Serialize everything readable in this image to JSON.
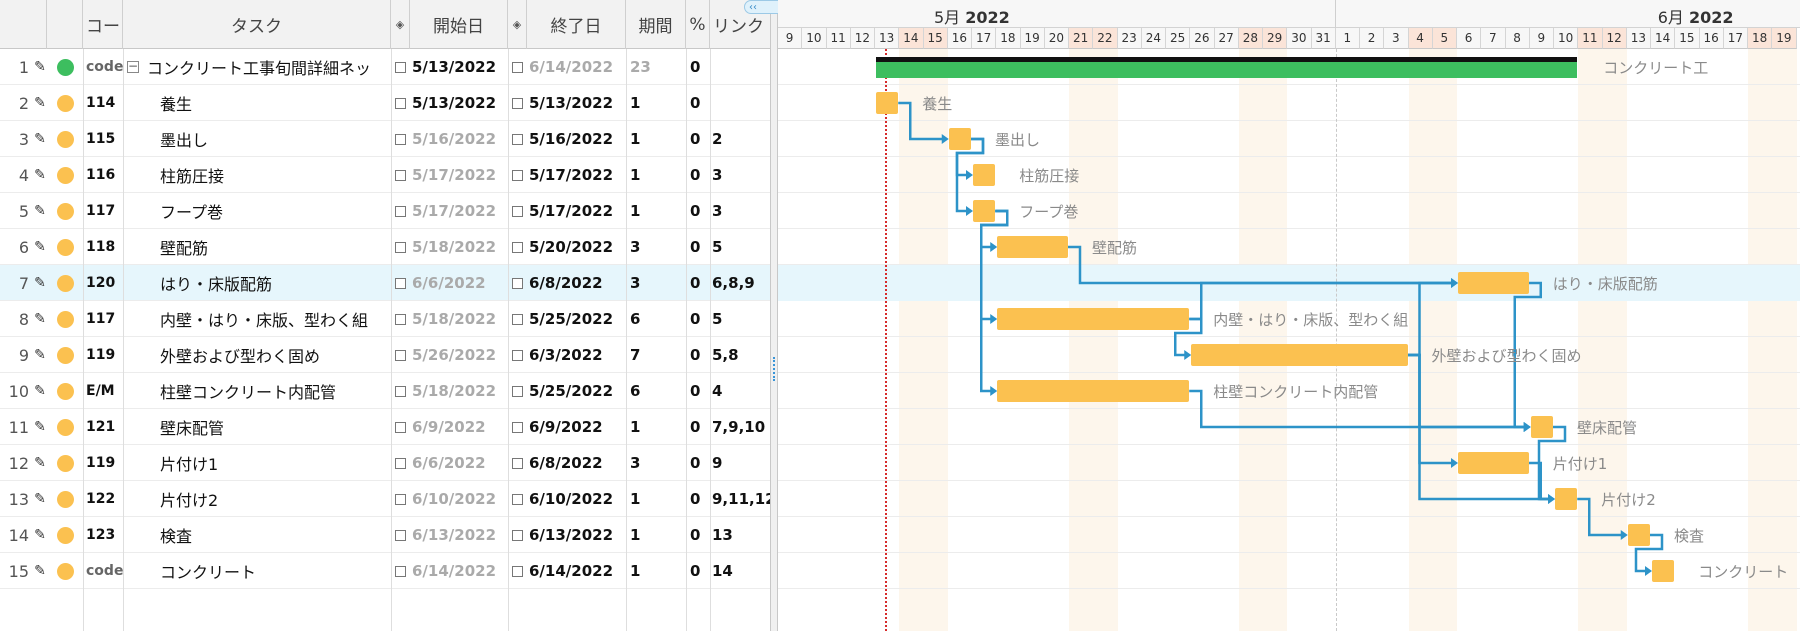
{
  "columns": {
    "code": "コー",
    "task": "タスク",
    "start": "開始日",
    "end": "終了日",
    "dur": "期間",
    "pct": "%",
    "link": "リンク"
  },
  "months": [
    {
      "month": "5月",
      "year": "2022"
    },
    {
      "month": "6月",
      "year": "2022"
    }
  ],
  "days": [
    "9",
    "10",
    "11",
    "12",
    "13",
    "14",
    "15",
    "16",
    "17",
    "18",
    "19",
    "20",
    "21",
    "22",
    "23",
    "24",
    "25",
    "26",
    "27",
    "28",
    "29",
    "30",
    "31",
    "1",
    "2",
    "3",
    "4",
    "5",
    "6",
    "7",
    "8",
    "9",
    "10",
    "11",
    "12",
    "13",
    "14",
    "15",
    "16",
    "17",
    "18",
    "19"
  ],
  "colors": {
    "summary": "#3dbe5f",
    "task": "#fbc150",
    "link": "#2d93c8",
    "today": "#d62b2b",
    "weekend_header": "#fbe4d8",
    "selected_row": "#e6f6fc"
  },
  "rows": [
    {
      "n": "1",
      "code": "code",
      "task": "コンクリート工事旬間詳細ネッ",
      "start": "5/13/2022",
      "end": "6/14/2022",
      "dur": "23",
      "pct": "0",
      "link": "",
      "summary": true
    },
    {
      "n": "2",
      "code": "114",
      "task": "養生",
      "start": "5/13/2022",
      "end": "5/13/2022",
      "dur": "1",
      "pct": "0",
      "link": "",
      "start_active": true
    },
    {
      "n": "3",
      "code": "115",
      "task": "墨出し",
      "start": "5/16/2022",
      "end": "5/16/2022",
      "dur": "1",
      "pct": "0",
      "link": "2"
    },
    {
      "n": "4",
      "code": "116",
      "task": "柱筋圧接",
      "start": "5/17/2022",
      "end": "5/17/2022",
      "dur": "1",
      "pct": "0",
      "link": "3"
    },
    {
      "n": "5",
      "code": "117",
      "task": "フープ巻",
      "start": "5/17/2022",
      "end": "5/17/2022",
      "dur": "1",
      "pct": "0",
      "link": "3"
    },
    {
      "n": "6",
      "code": "118",
      "task": "壁配筋",
      "start": "5/18/2022",
      "end": "5/20/2022",
      "dur": "3",
      "pct": "0",
      "link": "5"
    },
    {
      "n": "7",
      "code": "120",
      "task": "はり・床版配筋",
      "start": "6/6/2022",
      "end": "6/8/2022",
      "dur": "3",
      "pct": "0",
      "link": "6,8,9",
      "selected": true
    },
    {
      "n": "8",
      "code": "117",
      "task": "内壁・はり・床版、型わく組",
      "start": "5/18/2022",
      "end": "5/25/2022",
      "dur": "6",
      "pct": "0",
      "link": "5"
    },
    {
      "n": "9",
      "code": "119",
      "task": "外壁および型わく固め",
      "start": "5/26/2022",
      "end": "6/3/2022",
      "dur": "7",
      "pct": "0",
      "link": "5,8"
    },
    {
      "n": "10",
      "code": "E/M",
      "task": "柱壁コンクリート内配管",
      "start": "5/18/2022",
      "end": "5/25/2022",
      "dur": "6",
      "pct": "0",
      "link": "4"
    },
    {
      "n": "11",
      "code": "121",
      "task": "壁床配管",
      "start": "6/9/2022",
      "end": "6/9/2022",
      "dur": "1",
      "pct": "0",
      "link": "7,9,10"
    },
    {
      "n": "12",
      "code": "119",
      "task": "片付け1",
      "start": "6/6/2022",
      "end": "6/8/2022",
      "dur": "3",
      "pct": "0",
      "link": "9"
    },
    {
      "n": "13",
      "code": "122",
      "task": "片付け2",
      "start": "6/10/2022",
      "end": "6/10/2022",
      "dur": "1",
      "pct": "0",
      "link": "9,11,12"
    },
    {
      "n": "14",
      "code": "123",
      "task": "検査",
      "start": "6/13/2022",
      "end": "6/13/2022",
      "dur": "1",
      "pct": "0",
      "link": "13"
    },
    {
      "n": "15",
      "code": "code",
      "task": "コンクリート",
      "start": "6/14/2022",
      "end": "6/14/2022",
      "dur": "1",
      "pct": "0",
      "link": "14"
    }
  ],
  "bar_labels": [
    "コンクリート工",
    "養生",
    "墨出し",
    "柱筋圧接",
    "フープ巻",
    "壁配筋",
    "はり・床版配筋",
    "内壁・はり・床版、型わく組",
    "外壁および型わく固め",
    "柱壁コンクリート内配管",
    "壁床配管",
    "片付け1",
    "片付け2",
    "検査",
    "コンクリート"
  ],
  "icons": {
    "edit": "pencil-icon",
    "collapse": "minus-box-icon",
    "milestone": "diamond-icon",
    "scroll": "chevron-icons"
  }
}
